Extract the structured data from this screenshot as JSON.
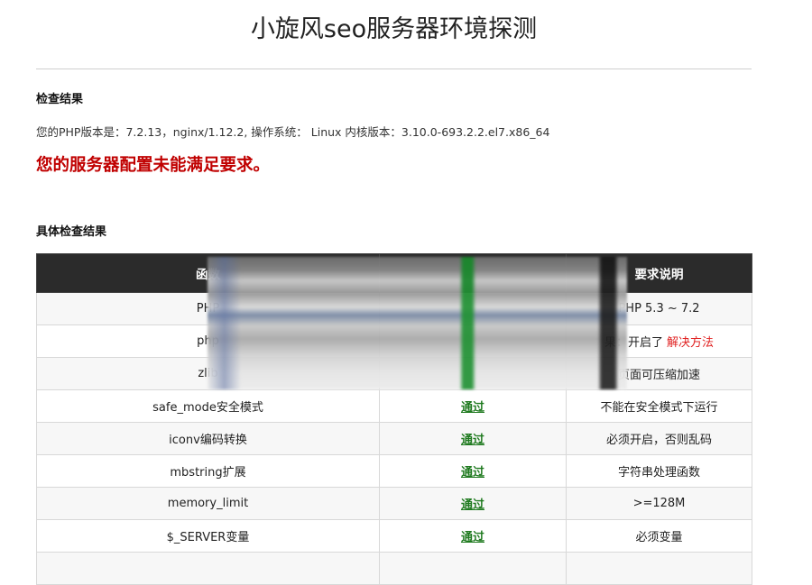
{
  "page": {
    "title": "小旋风seo服务器环境探测"
  },
  "check_result": {
    "heading": "检查结果",
    "info": "您的PHP版本是：7.2.13，nginx/1.12.2, 操作系统： Linux 内核版本：3.10.0-693.2.2.el7.x86_64",
    "warning": "您的服务器配置未能满足要求。"
  },
  "detail": {
    "heading": "具体检查结果",
    "columns": [
      "函数",
      "",
      "要求说明"
    ],
    "rows": [
      {
        "name": "PHP",
        "status": "",
        "desc": "PHP 5.3 ~ 7.2",
        "link": ""
      },
      {
        "name": "php",
        "status": "",
        "desc": "果：开启了",
        "link": "解决方法"
      },
      {
        "name": "zlib",
        "status": "",
        "desc": "页面可压缩加速",
        "link": ""
      },
      {
        "name": "safe_mode安全模式",
        "status": "通过",
        "desc": "不能在安全模式下运行",
        "link": ""
      },
      {
        "name": "iconv编码转换",
        "status": "通过",
        "desc": "必须开启，否则乱码",
        "link": ""
      },
      {
        "name": "mbstring扩展",
        "status": "通过",
        "desc": "字符串处理函数",
        "link": ""
      },
      {
        "name": "memory_limit",
        "status": "通过",
        "desc": ">=128M",
        "link": ""
      },
      {
        "name": "$_SERVER变量",
        "status": "通过",
        "desc": "必须变量",
        "link": ""
      },
      {
        "name": "",
        "status": "",
        "desc": "",
        "link": ""
      }
    ]
  },
  "colors": {
    "warning": "#c00000",
    "pass": "#1f7a1f",
    "header_bg": "#2b2b2b",
    "link": "#e02020"
  }
}
